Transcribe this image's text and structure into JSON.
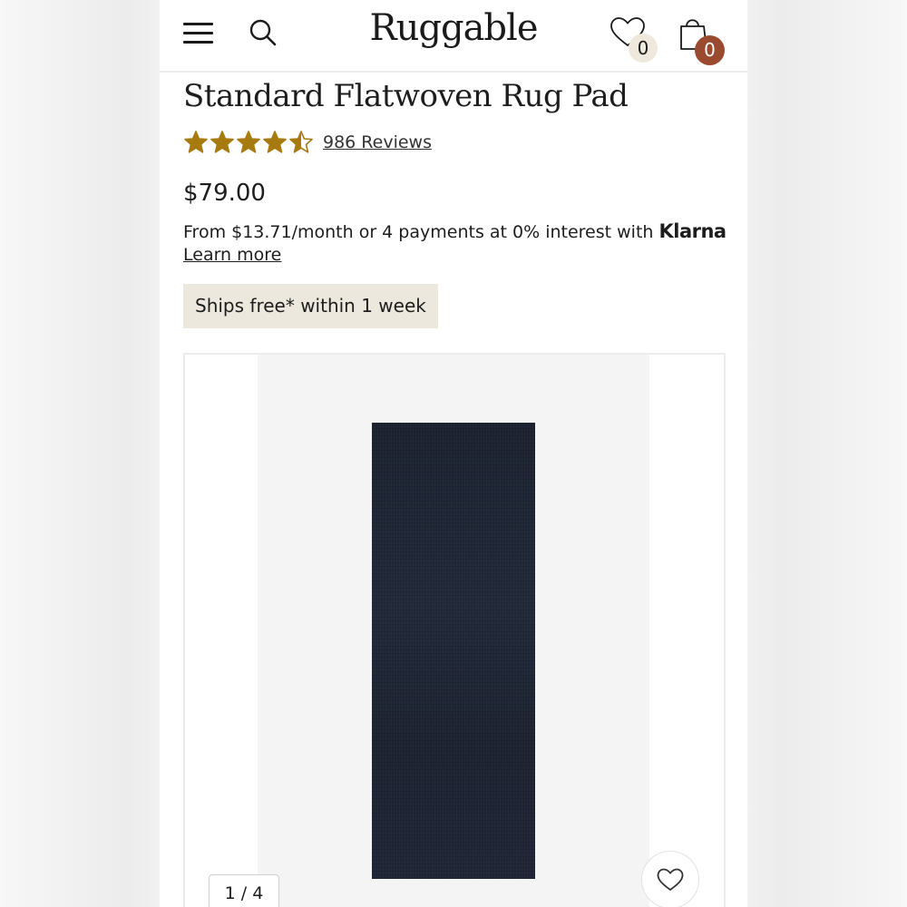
{
  "header": {
    "menu_icon": "hamburger-menu-icon",
    "search_icon": "search-icon",
    "logo": "Ruggable",
    "wishlist_icon": "heart-icon",
    "wishlist_count": "0",
    "cart_icon": "shopping-bag-icon",
    "cart_count": "0"
  },
  "product": {
    "title": "Standard Flatwoven Rug Pad",
    "rating": 4.5,
    "rating_max": 5,
    "star_color": "#a77a10",
    "reviews_label": "986 Reviews",
    "price": "$79.00",
    "financing_text": "From $13.71/month or 4 payments at 0% interest with",
    "financing_brand": "Klarna",
    "learn_more": "Learn more",
    "shipping_badge": "Ships free* within 1 week"
  },
  "gallery": {
    "counter": "1 / 4",
    "favorite_icon": "heart-outline-icon"
  },
  "colors": {
    "cart_badge": "#9a4a2f",
    "wishlist_badge": "#efe9dd",
    "shipping_badge_bg": "#ece8dd"
  }
}
